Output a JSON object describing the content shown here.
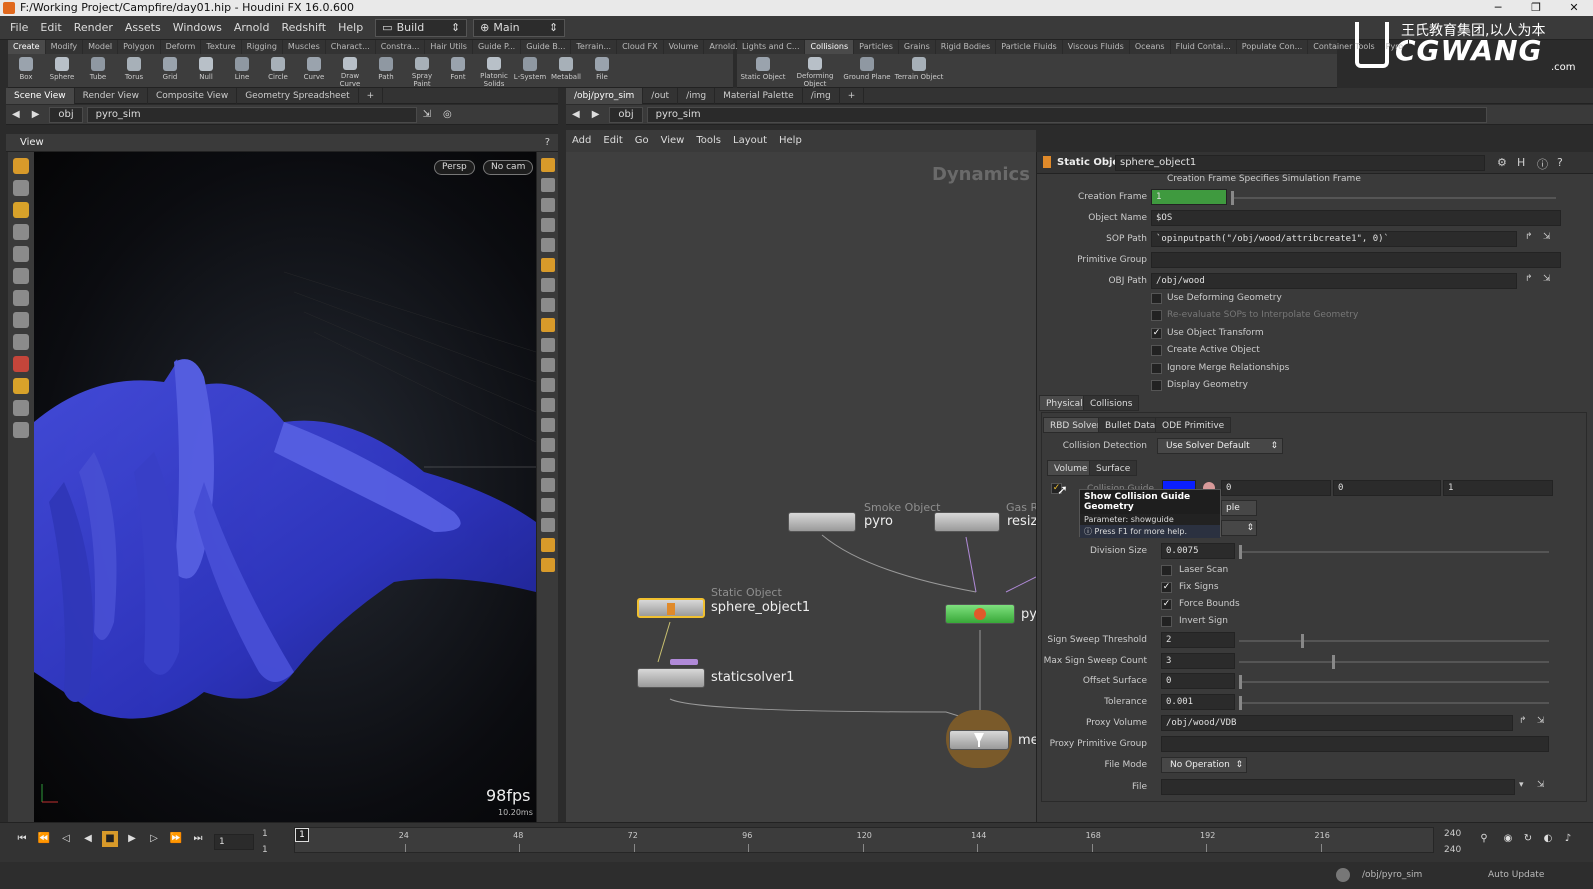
{
  "window": {
    "title": "F:/Working Project/Campfire/day01.hip - Houdini FX 16.0.600"
  },
  "menu": {
    "items": [
      "File",
      "Edit",
      "Render",
      "Assets",
      "Windows",
      "Arnold",
      "Redshift",
      "Help"
    ],
    "desktop": "Build",
    "context": "Main"
  },
  "shelf_left": {
    "tabs": [
      "Create",
      "Modify",
      "Model",
      "Polygon",
      "Deform",
      "Texture",
      "Rigging",
      "Muscles",
      "Charact...",
      "Constra...",
      "Hair Utils",
      "Guide P...",
      "Guide B...",
      "Terrain...",
      "Cloud FX",
      "Volume",
      "Arnold..."
    ],
    "tools": [
      "Box",
      "Sphere",
      "Tube",
      "Torus",
      "Grid",
      "Null",
      "Line",
      "Circle",
      "Curve",
      "Draw Curve",
      "Path",
      "Spray Paint",
      "Font",
      "Platonic Solids",
      "L-System",
      "Metaball",
      "File"
    ]
  },
  "shelf_right": {
    "tabs": [
      "Lights and C...",
      "Collisions",
      "Particles",
      "Grains",
      "Rigid Bodies",
      "Particle Fluids",
      "Viscous Fluids",
      "Oceans",
      "Fluid Contai...",
      "Populate Con...",
      "Container Tools",
      "Pyro"
    ],
    "tools": [
      "Static Object",
      "Deforming Object",
      "Ground Plane",
      "Terrain Object"
    ]
  },
  "watermark": {
    "cn": "王氏教育集团,以人为本",
    "brand": "CGWANG",
    "domain": ".com"
  },
  "left_pane": {
    "tabs": [
      "Scene View",
      "Render View",
      "Composite View",
      "Geometry Spreadsheet"
    ],
    "path": [
      "obj",
      "pyro_sim"
    ],
    "view_title": "View",
    "persp": "Persp",
    "cam": "No cam",
    "fps": "98fps",
    "ms": "10.20ms"
  },
  "network": {
    "tabs": [
      "/obj/pyro_sim",
      "/out",
      "/img",
      "Material Palette",
      "/img"
    ],
    "path": [
      "obj",
      "pyro_sim"
    ],
    "menu": [
      "Add",
      "Edit",
      "Go",
      "View",
      "Tools",
      "Layout",
      "Help"
    ],
    "context_label": "Dynamics",
    "nodes": {
      "smoke_type": "Smoke Object",
      "smoke_name": "pyro",
      "gas_type": "Gas R",
      "gas_name": "resiz",
      "static_type": "Static Object",
      "static_name": "sphere_object1",
      "solver_name": "staticsolver1",
      "py_name": "py",
      "merge_name": "me"
    }
  },
  "params": {
    "node_type": "Static Object",
    "node_name": "sphere_object1",
    "top_note": "Creation Frame Specifies Simulation Frame",
    "creation_frame_label": "Creation Frame",
    "creation_frame": "1",
    "object_name_label": "Object Name",
    "object_name": "$OS",
    "sop_path_label": "SOP Path",
    "sop_path": "`opinputpath(\"/obj/wood/attribcreate1\", 0)`",
    "prim_group_label": "Primitive Group",
    "prim_group": "",
    "obj_path_label": "OBJ Path",
    "obj_path": "/obj/wood",
    "checks": [
      {
        "label": "Use Deforming Geometry",
        "checked": false
      },
      {
        "label": "Re-evaluate SOPs to Interpolate Geometry",
        "checked": false
      },
      {
        "label": "Use Object Transform",
        "checked": true
      },
      {
        "label": "Create Active Object",
        "checked": false
      },
      {
        "label": "Ignore Merge Relationships",
        "checked": false
      },
      {
        "label": "Display Geometry",
        "checked": false
      }
    ],
    "tabs1": [
      "Physical",
      "Collisions"
    ],
    "tabs2": [
      "RBD Solver",
      "Bullet Data",
      "ODE Primitive"
    ],
    "collision_detection_label": "Collision Detection",
    "collision_detection": "Use Solver Default",
    "tabs3": [
      "Volume",
      "Surface"
    ],
    "guide_label": "Collision Guide",
    "guide_values": [
      "0",
      "0",
      "1"
    ],
    "guide_color": "#0a1fff",
    "tooltip_title": "Show Collision Guide Geometry",
    "tooltip_param": "Parameter: showguide",
    "tooltip_help": "Press F1 for more help.",
    "mode_partial": "ple",
    "division_size_label": "Division Size",
    "division_size": "0.0075",
    "checks2": [
      {
        "label": "Laser Scan",
        "checked": false
      },
      {
        "label": "Fix Signs",
        "checked": true
      },
      {
        "label": "Force Bounds",
        "checked": true
      },
      {
        "label": "Invert Sign",
        "checked": false
      }
    ],
    "sweep_threshold_label": "Sign Sweep Threshold",
    "sweep_threshold": "2",
    "max_sweep_label": "Max Sign Sweep Count",
    "max_sweep": "3",
    "offset_label": "Offset Surface",
    "offset": "0",
    "tolerance_label": "Tolerance",
    "tolerance": "0.001",
    "proxy_volume_label": "Proxy Volume",
    "proxy_volume": "/obj/wood/VDB",
    "proxy_group_label": "Proxy Primitive Group",
    "proxy_group": "",
    "file_mode_label": "File Mode",
    "file_mode": "No Operation",
    "file_label": "File",
    "file": ""
  },
  "timeline": {
    "frame": "1",
    "start": "1",
    "start2": "1",
    "ticks": [
      "24",
      "48",
      "72",
      "96",
      "120",
      "144",
      "168",
      "192",
      "216"
    ],
    "end": "240",
    "end2": "240",
    "current_marker": "1"
  },
  "status": {
    "path": "/obj/pyro_sim",
    "update": "Auto Update"
  }
}
